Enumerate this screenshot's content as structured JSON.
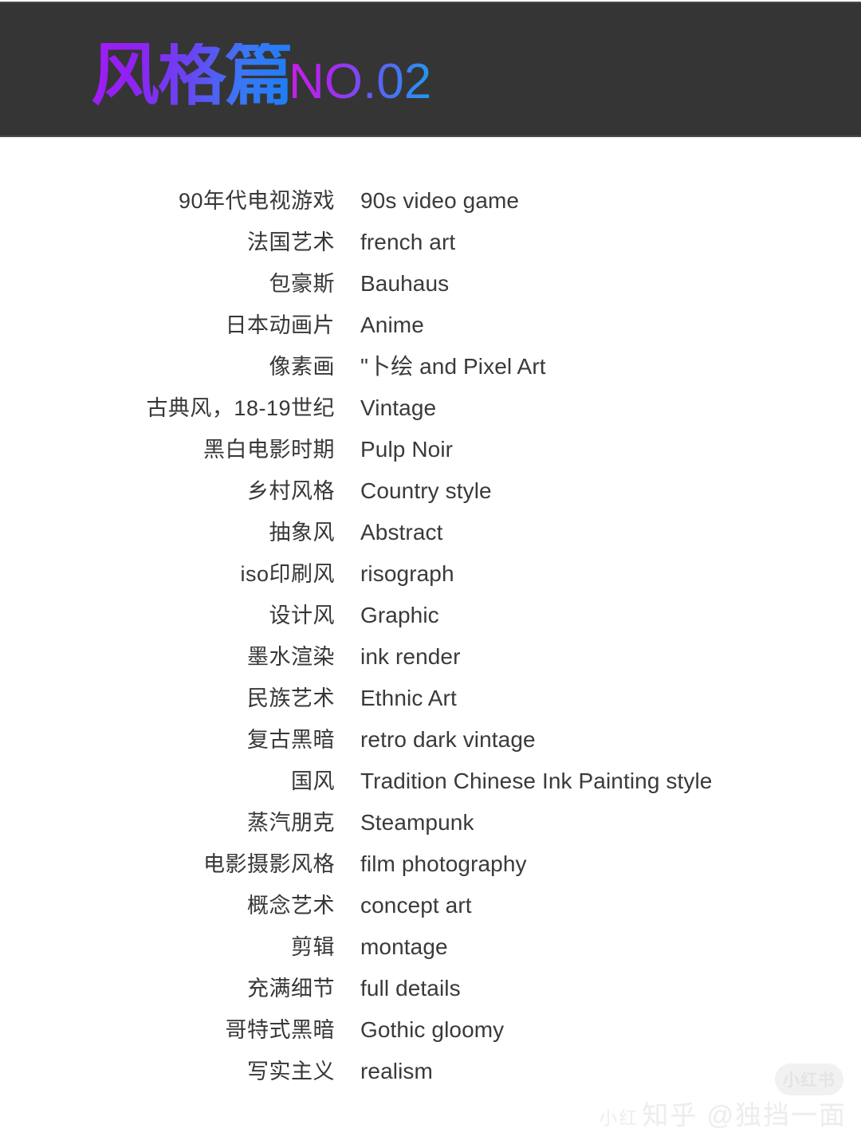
{
  "header": {
    "title_cn": "风格篇",
    "title_no": "NO.02",
    "bar_color": "#353535",
    "gradient_start": "#a21cf5",
    "gradient_end": "#1a7ff5",
    "no_gradient_start": "#c71fe8",
    "no_gradient_end": "#1f9bf0"
  },
  "table": {
    "rows": [
      {
        "cn": "90年代电视游戏",
        "en": "90s video game"
      },
      {
        "cn": "法国艺术",
        "en": "french art"
      },
      {
        "cn": "包豪斯",
        "en": "Bauhaus"
      },
      {
        "cn": "日本动画片",
        "en": "Anime"
      },
      {
        "cn": "像素画",
        "en": "\"卜绘 and Pixel Art"
      },
      {
        "cn": "古典风，18-19世纪",
        "en": "Vintage"
      },
      {
        "cn": "黑白电影时期",
        "en": "Pulp Noir"
      },
      {
        "cn": "乡村风格",
        "en": "Country style"
      },
      {
        "cn": "抽象风",
        "en": "Abstract"
      },
      {
        "cn": "iso印刷风",
        "en": "risograph"
      },
      {
        "cn": "设计风",
        "en": "Graphic"
      },
      {
        "cn": "墨水渲染",
        "en": "ink render"
      },
      {
        "cn": "民族艺术",
        "en": "Ethnic Art"
      },
      {
        "cn": "复古黑暗",
        "en": "retro dark vintage"
      },
      {
        "cn": "国风",
        "en": "Tradition Chinese Ink Painting style"
      },
      {
        "cn": "蒸汽朋克",
        "en": "Steampunk"
      },
      {
        "cn": "电影摄影风格",
        "en": "film photography"
      },
      {
        "cn": "概念艺术",
        "en": "concept art"
      },
      {
        "cn": "剪辑",
        "en": "montage"
      },
      {
        "cn": "充满细节",
        "en": "full details"
      },
      {
        "cn": "哥特式黑暗",
        "en": "Gothic gloomy"
      },
      {
        "cn": "写实主义",
        "en": "realism"
      }
    ]
  },
  "watermark": {
    "badge": "小红书",
    "platform": "知乎",
    "prefix": "小红",
    "handle": "@独挡一面"
  }
}
